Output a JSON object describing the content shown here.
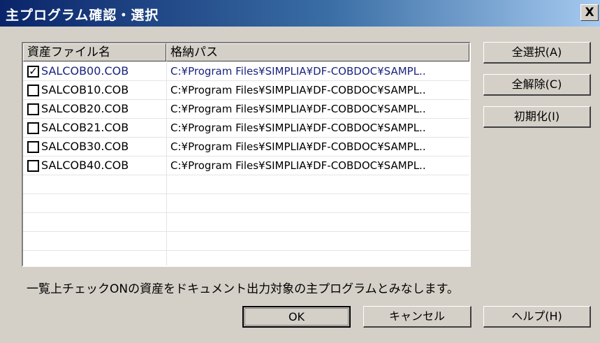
{
  "window": {
    "title": "主プログラム確認・選択",
    "close_label": "X"
  },
  "list": {
    "headers": [
      "資産ファイル名",
      "格納パス"
    ],
    "rows": [
      {
        "checked": true,
        "name": "SALCOB00.COB",
        "path": "C:¥Program Files¥SIMPLIA¥DF-COBDOC¥SAMPL.."
      },
      {
        "checked": false,
        "name": "SALCOB10.COB",
        "path": "C:¥Program Files¥SIMPLIA¥DF-COBDOC¥SAMPL.."
      },
      {
        "checked": false,
        "name": "SALCOB20.COB",
        "path": "C:¥Program Files¥SIMPLIA¥DF-COBDOC¥SAMPL.."
      },
      {
        "checked": false,
        "name": "SALCOB21.COB",
        "path": "C:¥Program Files¥SIMPLIA¥DF-COBDOC¥SAMPL.."
      },
      {
        "checked": false,
        "name": "SALCOB30.COB",
        "path": "C:¥Program Files¥SIMPLIA¥DF-COBDOC¥SAMPL.."
      },
      {
        "checked": false,
        "name": "SALCOB40.COB",
        "path": "C:¥Program Files¥SIMPLIA¥DF-COBDOC¥SAMPL.."
      }
    ],
    "check_mark": "✓"
  },
  "side_buttons": {
    "select_all": "全選択(A)",
    "clear_all": "全解除(C)",
    "reset": "初期化(I)"
  },
  "note": "一覧上チェックONの資産をドキュメント出力対象の主プログラムとみなします。",
  "footer_buttons": {
    "ok": "OK",
    "cancel": "キャンセル",
    "help": "ヘルプ(H)"
  },
  "colors": {
    "title_start": "#0a246a",
    "title_end": "#a6caf0",
    "face": "#d4d0c8",
    "selected_text": "#1a237e"
  }
}
